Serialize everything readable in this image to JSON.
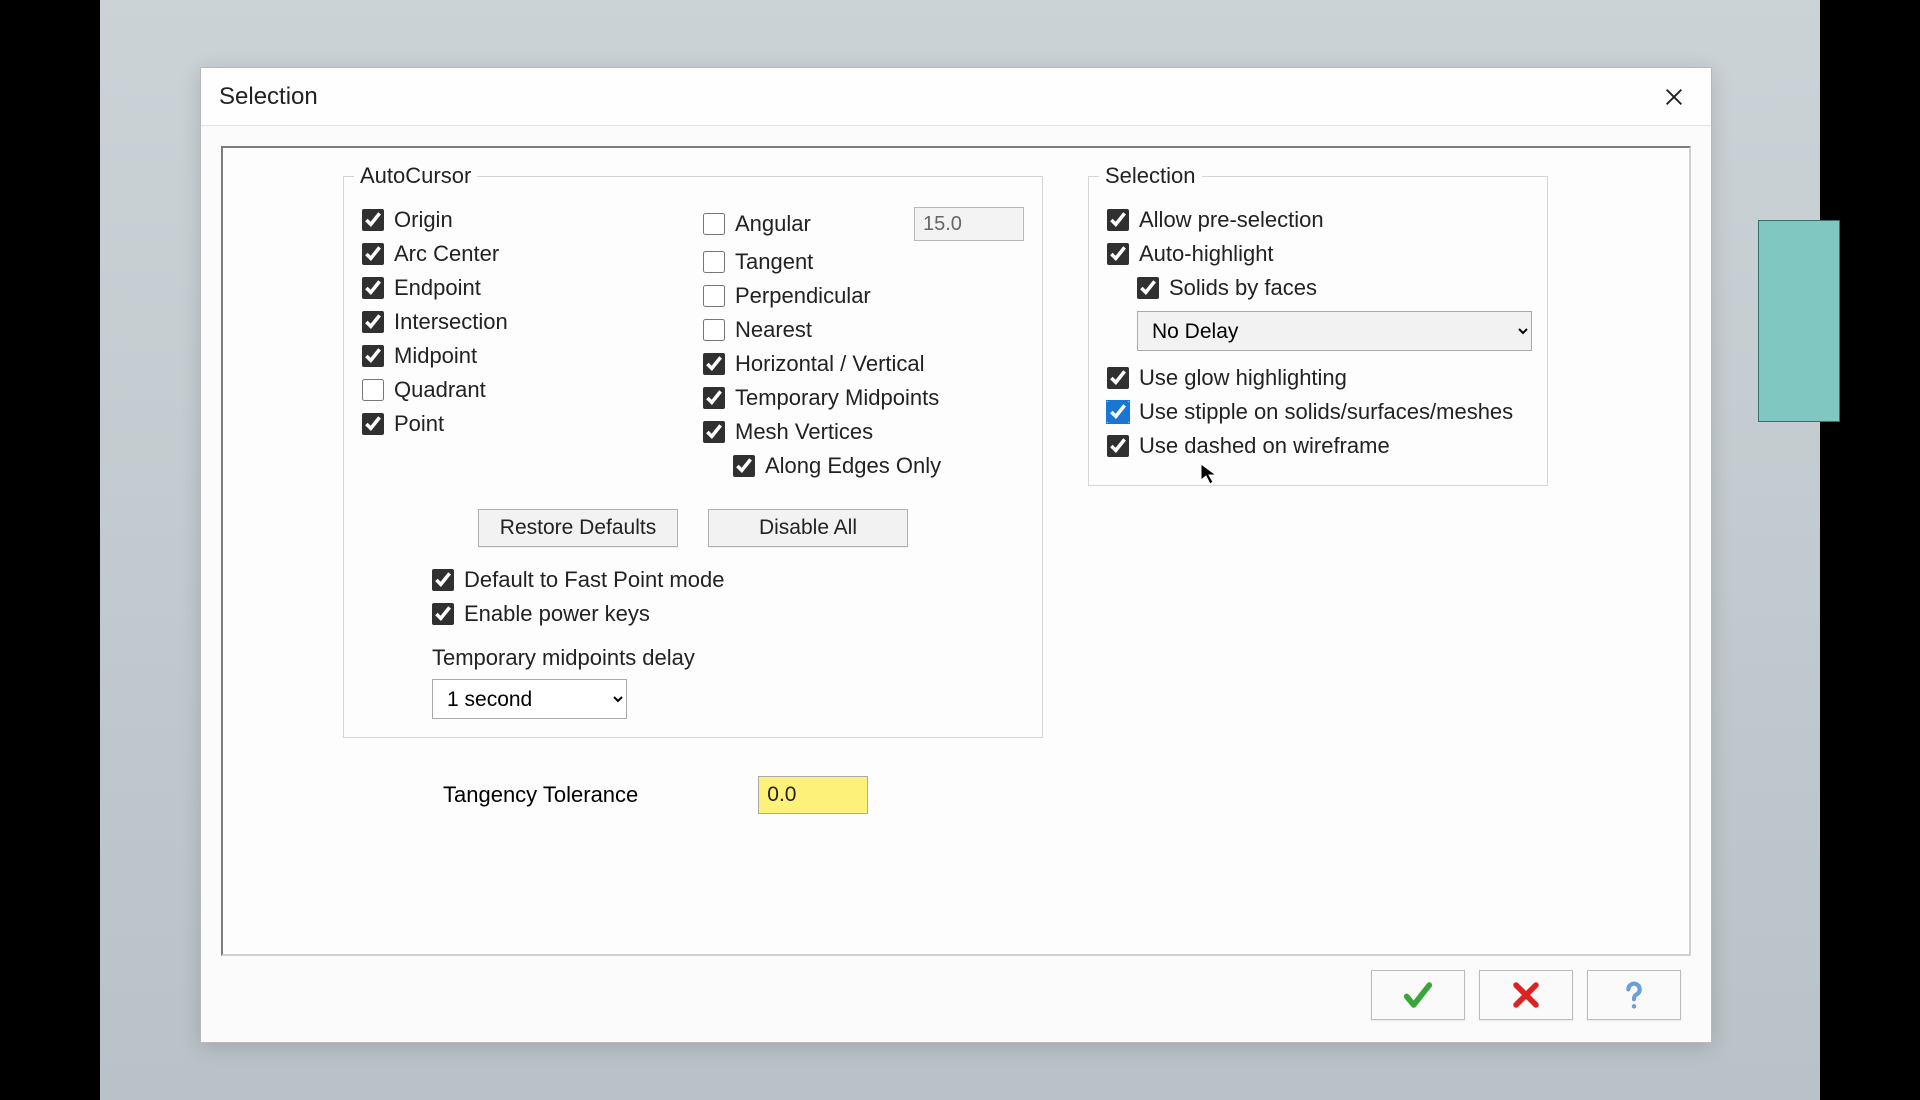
{
  "dialog": {
    "title": "Selection"
  },
  "autocursor": {
    "title": "AutoCursor",
    "col1": [
      {
        "label": "Origin",
        "checked": true
      },
      {
        "label": "Arc Center",
        "checked": true
      },
      {
        "label": "Endpoint",
        "checked": true
      },
      {
        "label": "Intersection",
        "checked": true
      },
      {
        "label": "Midpoint",
        "checked": true
      },
      {
        "label": "Quadrant",
        "checked": false
      },
      {
        "label": "Point",
        "checked": true
      }
    ],
    "col2": [
      {
        "label": "Angular",
        "checked": false,
        "value": "15.0"
      },
      {
        "label": "Tangent",
        "checked": false
      },
      {
        "label": "Perpendicular",
        "checked": false
      },
      {
        "label": "Nearest",
        "checked": false
      },
      {
        "label": "Horizontal / Vertical",
        "checked": true
      },
      {
        "label": "Temporary Midpoints",
        "checked": true
      },
      {
        "label": "Mesh Vertices",
        "checked": true
      }
    ],
    "along_edges": {
      "label": "Along Edges Only",
      "checked": true
    },
    "restore_btn": "Restore Defaults",
    "disable_btn": "Disable All",
    "fast_point": {
      "label": "Default to Fast Point mode",
      "checked": true
    },
    "power_keys": {
      "label": "Enable power keys",
      "checked": true
    },
    "temp_mid_label": "Temporary midpoints delay",
    "temp_mid_value": "1 second"
  },
  "tangency": {
    "label": "Tangency Tolerance",
    "value": "0.0"
  },
  "selection": {
    "title": "Selection",
    "pre": {
      "label": "Allow pre-selection",
      "checked": true
    },
    "auto_hl": {
      "label": "Auto-highlight",
      "checked": true
    },
    "solids_faces": {
      "label": "Solids by faces",
      "checked": true
    },
    "delay_value": "No Delay",
    "glow": {
      "label": "Use glow highlighting",
      "checked": true
    },
    "stipple": {
      "label": "Use stipple on solids/surfaces/meshes",
      "checked": true
    },
    "dashed": {
      "label": "Use dashed on wireframe",
      "checked": true
    }
  }
}
